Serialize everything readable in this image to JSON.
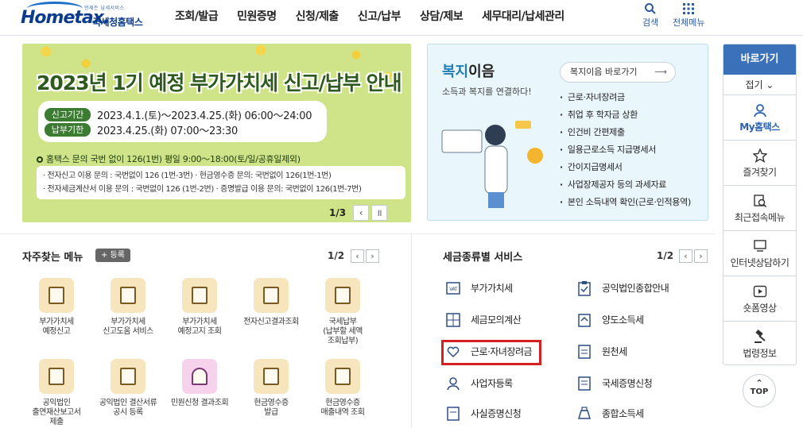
{
  "header": {
    "logo_tagline": "언제든 납세서비스",
    "logo_text": "Hometax.",
    "logo_kr": "국세청홈택스",
    "menu": [
      "조회/발급",
      "민원증명",
      "신청/제출",
      "신고/납부",
      "상담/제보",
      "세무대리/납세관리"
    ],
    "search_label": "검색",
    "all_menu_label": "전체메뉴"
  },
  "banner": {
    "title": "2023년 1기 예정 부가가치세 신고/납부 안내",
    "period_label": "신고기간",
    "period_value": "2023.4.1.(토)～2023.4.25.(화) 06:00～24:00",
    "due_label": "납부기한",
    "due_value": "2023.4.25.(화) 07:00～23:30",
    "inquiry": "홈택스 문의 국번 없이 126(1번) 평일 9:00～18:00(토/일/공휴일제외)",
    "lines": [
      "· 전자신고 이용 문의 : 국번없이 126 (1번-3번)    · 현금영수증 문의: 국번없이 126(1번-1번)",
      "· 전자세금계산서 이용 문의 : 국번없이 126 (1번-2번)    · 증명발급 이용 문의: 국번없이 126(1번-7번)"
    ],
    "pager": "1/3"
  },
  "welfare": {
    "title_a": "복지",
    "title_b": "이음",
    "subtitle": "소득과 복지를 연결하다!",
    "go_label": "복지이음 바로가기",
    "items": [
      "근로·자녀장려금",
      "취업 후 학자금 상환",
      "인건비 간편제출",
      "일용근로소득 지급명세서",
      "간이지급명세서",
      "사업장제공자 등의 과세자료",
      "본인 소득내역 확인(근로·인적용역)"
    ]
  },
  "quick": {
    "title": "바로가기",
    "fold": "접기",
    "items": [
      "My홈택스",
      "즐겨찾기",
      "최근접속메뉴",
      "인터넷상담하기",
      "숏폼영상",
      "법령정보"
    ],
    "top": "TOP"
  },
  "favorites": {
    "title": "자주찾는 메뉴",
    "register": "+ 등록",
    "pager": "1/2",
    "items": [
      [
        "부가가치세",
        "예정신고"
      ],
      [
        "부가가치세",
        "신고도움 서비스"
      ],
      [
        "부가가치세",
        "예정고지 조회"
      ],
      [
        "전자신고결과조회"
      ],
      [
        "국세납부",
        "(납부할 세액",
        "조회납부)"
      ],
      [
        "공익법인",
        "출연재산보고서",
        "제출"
      ],
      [
        "공익법인 결산서류",
        "공시 등록"
      ],
      [
        "민원신청 결과조회"
      ],
      [
        "현금영수증",
        "발급"
      ],
      [
        "현금영수증",
        "매출내역 조회"
      ]
    ]
  },
  "tax_services": {
    "title": "세금종류별 서비스",
    "pager": "1/2",
    "items": [
      "부가가치세",
      "공익법인종합안내",
      "세금모의계산",
      "양도소득세",
      "근로·자녀장려금",
      "원천세",
      "사업자등록",
      "국세증명신청",
      "사실증명신청",
      "종합소득세"
    ]
  }
}
